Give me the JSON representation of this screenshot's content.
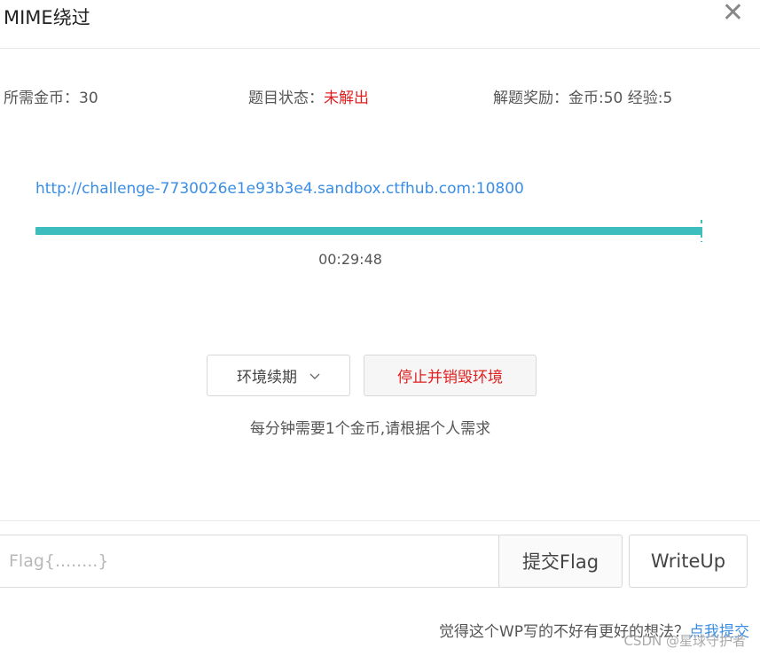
{
  "dialog": {
    "title": "MIME绕过",
    "close_icon": "close-icon"
  },
  "info": {
    "cost_label": "所需金币：30",
    "status_label": "题目状态：",
    "status_value": "未解出",
    "reward_label": "解题奖励：金币:50 经验:5"
  },
  "challenge": {
    "url": "http://challenge-7730026e1e93b3e4.sandbox.ctfhub.com:10800",
    "time_remaining": "00:29:48",
    "progress_fraction": 1.0
  },
  "actions": {
    "renew_label": "环境续期",
    "renew_icon": "chevron-down-icon",
    "stop_label": "停止并销毁环境",
    "note": "每分钟需要1个金币,请根据个人需求"
  },
  "flag": {
    "placeholder": "Flag{........}",
    "value": "",
    "submit_label": "提交Flag",
    "writeup_label": "WriteUp"
  },
  "footer": {
    "question": "觉得这个WP写的不好有更好的想法？",
    "link": "点我提交",
    "watermark": "CSDN @星球守护者"
  },
  "colors": {
    "accent": "#3dbdbd",
    "link": "#3a8ee6",
    "danger": "#e02020"
  }
}
